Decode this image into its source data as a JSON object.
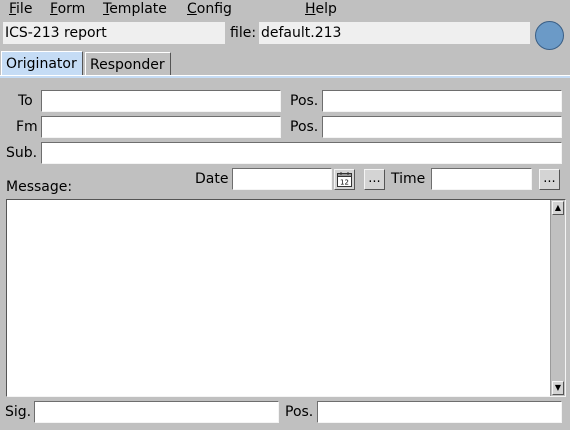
{
  "menubar": {
    "file": "File",
    "file_rest": "ile",
    "file_mn": "F",
    "form_mn": "F",
    "form_rest": "orm",
    "template_mn": "T",
    "template_rest": "emplate",
    "config_mn": "C",
    "config_rest": "onfig",
    "help_mn": "H",
    "help_rest": "elp"
  },
  "header": {
    "form_title": "ICS-213 report",
    "file_label": "file:",
    "file_name": "default.213"
  },
  "tabs": [
    {
      "label": "Originator",
      "active": true
    },
    {
      "label": "Responder",
      "active": false
    }
  ],
  "originator": {
    "to_label": "To",
    "from_label": "Fm",
    "pos_label": "Pos.",
    "subject_label": "Sub.",
    "message_label": "Message:",
    "date_label": "Date",
    "time_label": "Time",
    "ellipsis": "...",
    "calendar_text": "12",
    "sig_label": "Sig.",
    "to_value": "",
    "to_pos_value": "",
    "from_value": "",
    "from_pos_value": "",
    "subject_value": "",
    "date_value": "",
    "time_value": "",
    "message_value": "",
    "sig_value": "",
    "sig_pos_value": ""
  },
  "colors": {
    "background": "#c0c0c0",
    "active_tab": "#c5dcf5",
    "status_light": "#6b9ac7"
  },
  "icons": {
    "calendar": "calendar-icon",
    "scroll_up": "scroll-up-arrow-icon",
    "scroll_down": "scroll-down-arrow-icon"
  }
}
